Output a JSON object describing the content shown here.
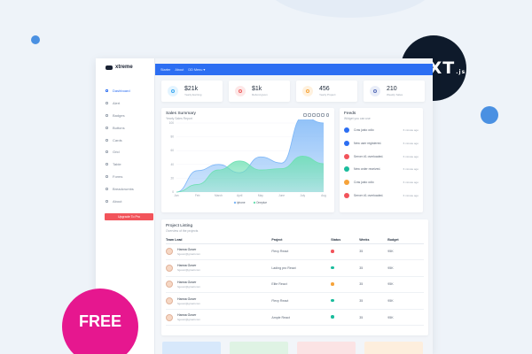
{
  "badges": {
    "next": "NEXT",
    "next_suffix": ".js",
    "free": "FREE"
  },
  "app": {
    "name": "xtreme",
    "upgrade": "Upgrade To Pro"
  },
  "sidebar": {
    "items": [
      {
        "label": "Dashboard",
        "active": true
      },
      {
        "label": "Alert"
      },
      {
        "label": "Badges"
      },
      {
        "label": "Buttons"
      },
      {
        "label": "Cards"
      },
      {
        "label": "Grid"
      },
      {
        "label": "Table"
      },
      {
        "label": "Forms"
      },
      {
        "label": "Breadcrumbs"
      },
      {
        "label": "About"
      }
    ]
  },
  "topbar": {
    "links": [
      "Starter",
      "About",
      "DD Menu ▾"
    ]
  },
  "stats": [
    {
      "value": "$21k",
      "label": "Yearly Earning",
      "bg": "#e3f4ff",
      "fg": "#3aa7f0"
    },
    {
      "value": "$1k",
      "label": "Refund given",
      "bg": "#fde7e7",
      "fg": "#ee5d5d"
    },
    {
      "value": "456",
      "label": "Yearly Project",
      "bg": "#fff1de",
      "fg": "#f6a33a"
    },
    {
      "value": "210",
      "label": "Weekly Sales",
      "bg": "#e9edf8",
      "fg": "#5a6fb8"
    }
  ],
  "sales": {
    "title": "Sales Summary",
    "subtitle": "Yearly Sales Report"
  },
  "chart_data": {
    "type": "area",
    "categories": [
      "Jan",
      "Feb",
      "March",
      "April",
      "May",
      "June",
      "July",
      "Aug"
    ],
    "series": [
      {
        "name": "iphone",
        "color": "#7cb6f7",
        "values": [
          0,
          31,
          40,
          28,
          51,
          42,
          109,
          100
        ]
      },
      {
        "name": "Oneplue",
        "color": "#6fe0b3",
        "values": [
          0,
          11,
          32,
          45,
          32,
          34,
          52,
          41
        ]
      }
    ],
    "ylim": [
      0,
      100
    ],
    "yticks": [
      0,
      20,
      40,
      60,
      80,
      100
    ],
    "legend_position": "bottom"
  },
  "feeds": {
    "title": "Feeds",
    "subtitle": "Widget you can use",
    "items": [
      {
        "text": "Cras justo odio",
        "time": "6 minute ago",
        "color": "#2c6ef2"
      },
      {
        "text": "New user registered.",
        "time": "6 minute ago",
        "color": "#2c6ef2"
      },
      {
        "text": "Server #1 overloaded.",
        "time": "6 minute ago",
        "color": "#f2545b"
      },
      {
        "text": "New order received.",
        "time": "6 minute ago",
        "color": "#1abc9c"
      },
      {
        "text": "Cras justo odio",
        "time": "6 minute ago",
        "color": "#f6a33a"
      },
      {
        "text": "Server #1 overloaded.",
        "time": "6 minute ago",
        "color": "#f2545b"
      }
    ]
  },
  "project": {
    "title": "Project Listing",
    "subtitle": "Overview of the projects",
    "columns": [
      "Team Lead",
      "Project",
      "Status",
      "Weeks",
      "Budget"
    ],
    "rows": [
      {
        "name": "Hanna Gover",
        "email": "hgover@gmail.com",
        "project": "Flexy React",
        "status": "#f2545b",
        "weeks": "35",
        "budget": "95K"
      },
      {
        "name": "Hanna Gover",
        "email": "hgover@gmail.com",
        "project": "Lading pro React",
        "status": "#1abc9c",
        "weeks": "35",
        "budget": "95K"
      },
      {
        "name": "Hanna Gover",
        "email": "hgover@gmail.com",
        "project": "Elite React",
        "status": "#f6a33a",
        "weeks": "35",
        "budget": "95K"
      },
      {
        "name": "Hanna Gover",
        "email": "hgover@gmail.com",
        "project": "Flexy React",
        "status": "#1abc9c",
        "weeks": "35",
        "budget": "95K"
      },
      {
        "name": "Hanna Gover",
        "email": "hgover@gmail.com",
        "project": "Ample React",
        "status": "#1abc9c",
        "weeks": "35",
        "budget": "95K"
      }
    ]
  },
  "bottom_cards": [
    "#d7e8fb",
    "#dff3e4",
    "#fbe3e4",
    "#fdeedd"
  ]
}
